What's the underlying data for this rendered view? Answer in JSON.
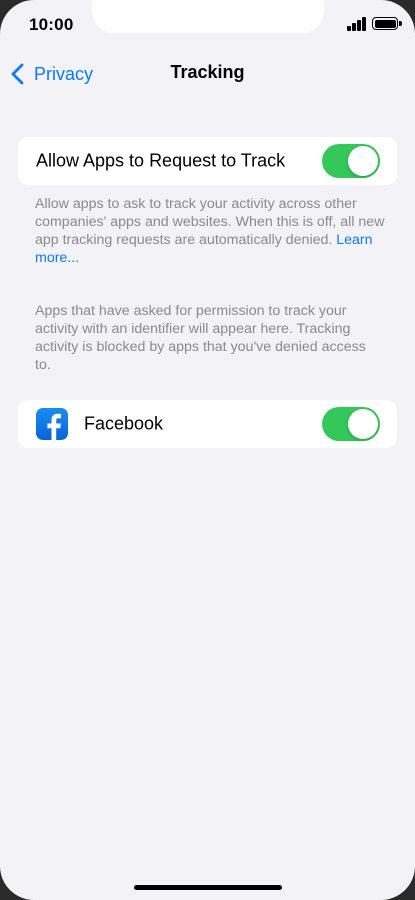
{
  "status_bar": {
    "time": "10:00"
  },
  "nav": {
    "back_label": "Privacy",
    "title": "Tracking"
  },
  "allow_tracking": {
    "label": "Allow Apps to Request to Track",
    "enabled": true,
    "description": "Allow apps to ask to track your activity across other companies' apps and websites. When this is off, all new app tracking requests are automatically denied. ",
    "link_text": "Learn more..."
  },
  "apps_section": {
    "description": "Apps that have asked for permission to track your activity with an identifier will appear here. Tracking activity is blocked by apps that you've denied access to.",
    "apps": [
      {
        "name": "Facebook",
        "icon": "facebook-icon",
        "enabled": true
      }
    ]
  },
  "colors": {
    "accent": "#0a7aff",
    "toggle_on": "#34c759",
    "background": "#f2f2f7"
  }
}
